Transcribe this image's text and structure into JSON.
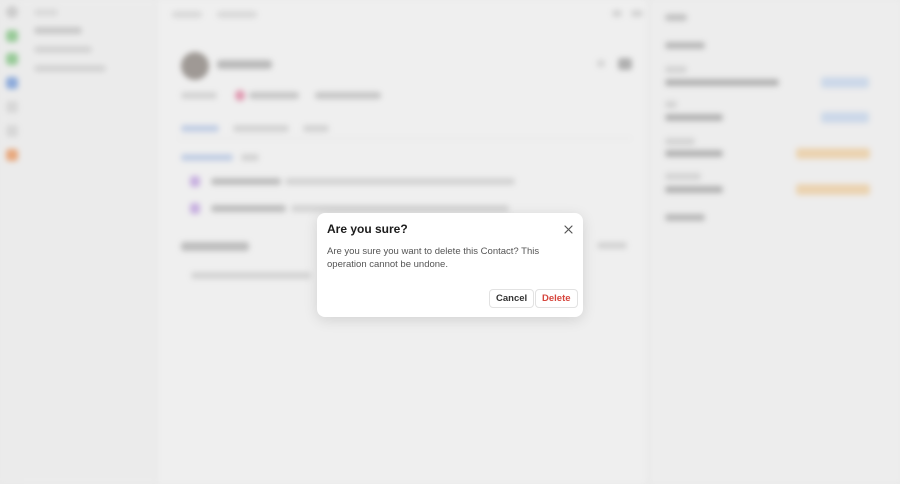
{
  "dialog": {
    "title": "Are you sure?",
    "message": "Are you sure you want to delete this Contact? This operation cannot be undone.",
    "cancel_label": "Cancel",
    "delete_label": "Delete",
    "close_icon": "close-icon"
  },
  "colors": {
    "danger": "#d6453c",
    "overlay": "#e1e1e1",
    "accent_blue": "#5b8dd9",
    "accent_orange": "#f0a040"
  }
}
